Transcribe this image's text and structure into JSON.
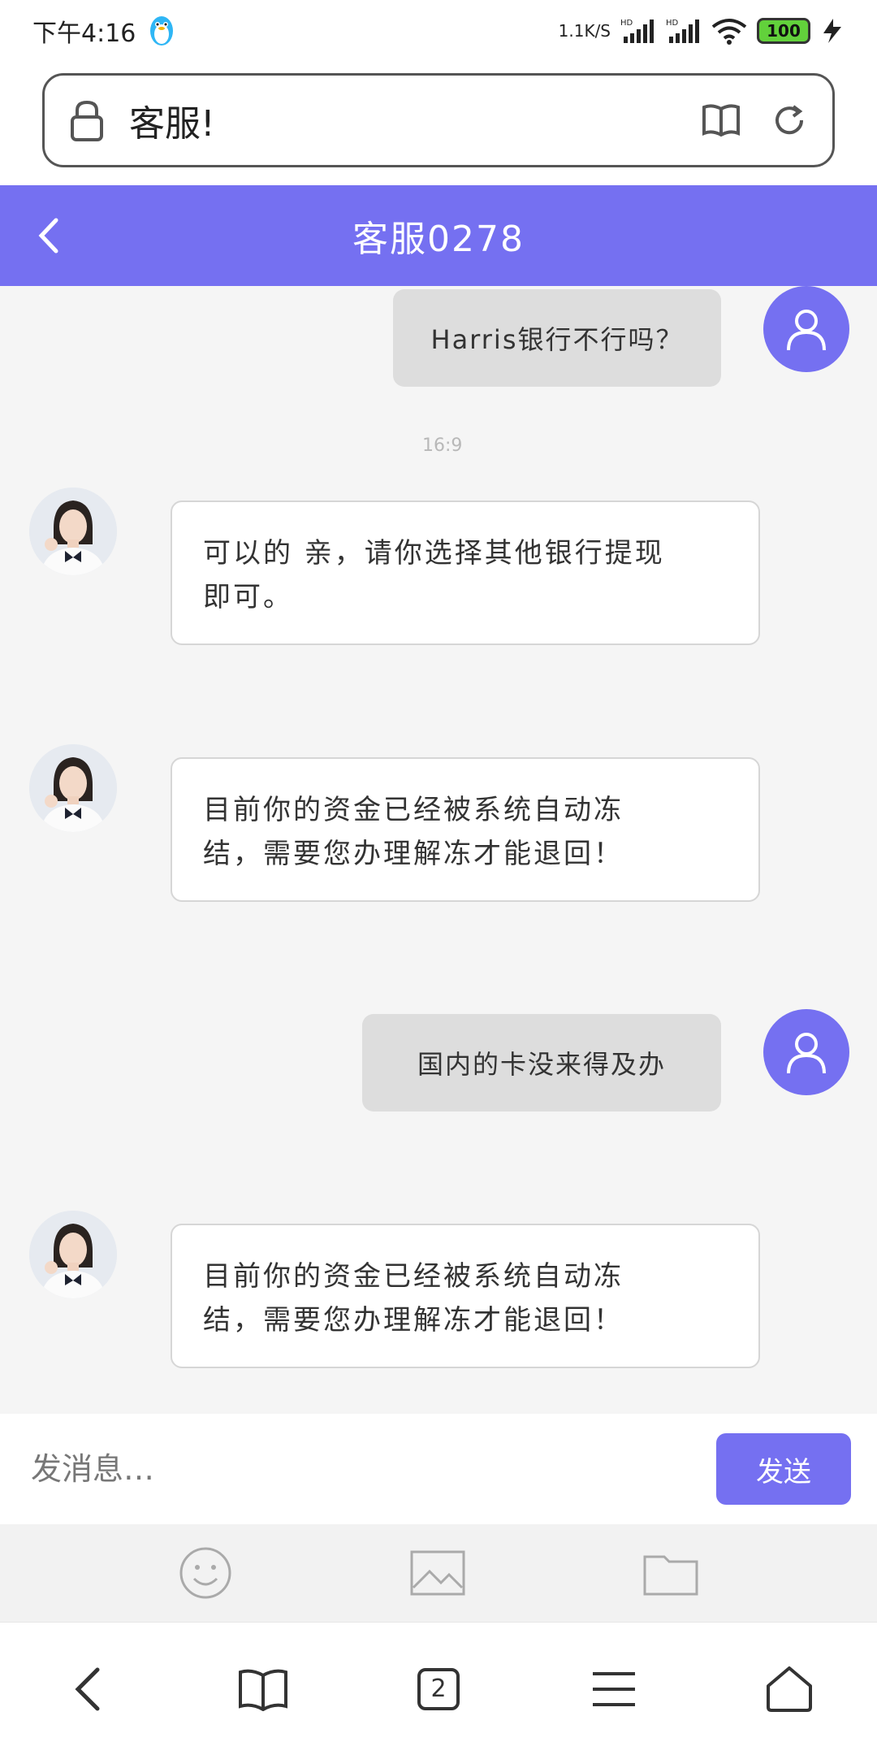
{
  "status_bar": {
    "time": "下午4:16",
    "net_speed": "1.1K/S",
    "signal1": "HD",
    "signal2": "HD",
    "battery": "100"
  },
  "url_bar": {
    "text": "客服!"
  },
  "header": {
    "title": "客服0278"
  },
  "chat": {
    "timestamp": "16:9",
    "messages": [
      {
        "from": "user",
        "text": "Harris银行不行吗？"
      },
      {
        "from": "agent",
        "line1": "可以的 亲，请你选择其他银行提现",
        "line2": "即可。"
      },
      {
        "from": "agent",
        "line1": "目前你的资金已经被系统自动冻",
        "line2": "结，需要您办理解冻才能退回！"
      },
      {
        "from": "user",
        "text": "国内的卡没来得及办"
      },
      {
        "from": "agent",
        "line1": "目前你的资金已经被系统自动冻",
        "line2": "结，需要您办理解冻才能退回！"
      }
    ]
  },
  "composer": {
    "placeholder": "发消息…",
    "send_label": "发送"
  },
  "tools": [
    "emoji-icon",
    "image-icon",
    "folder-icon"
  ],
  "nav": {
    "tab_count": "2"
  },
  "colors": {
    "accent": "#7570f1",
    "user_bubble": "#dddddd"
  }
}
